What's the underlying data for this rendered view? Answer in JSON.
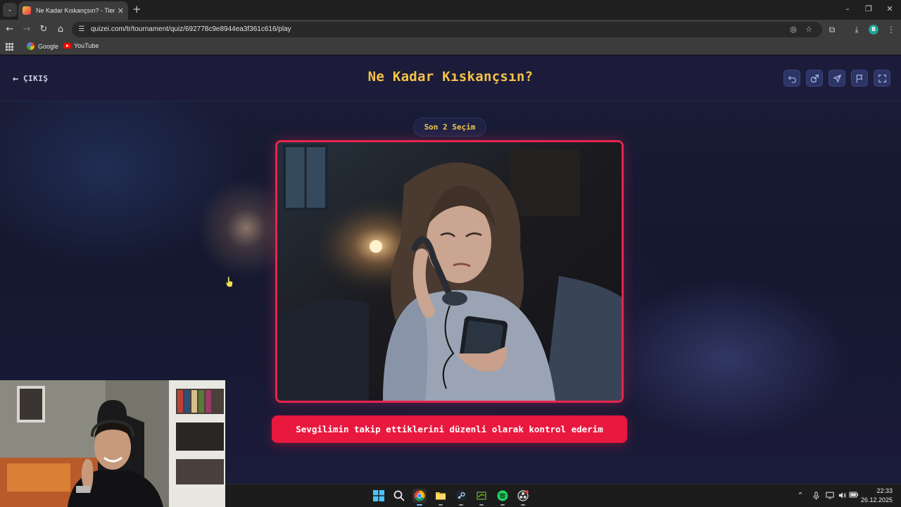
{
  "browser": {
    "tab_title": "Ne Kadar Kıskançsın? - Tier List",
    "url": "quizei.com/tr/tournament/quiz/692778c9e8944ea3f361c616/play",
    "profile_initial": "B",
    "bookmarks": [
      {
        "label": "Google",
        "icon": "google-icon"
      },
      {
        "label": "YouTube",
        "icon": "youtube-icon"
      }
    ]
  },
  "header": {
    "exit_label": "ÇIKIŞ",
    "title": "Ne Kadar Kıskançsın?",
    "actions": [
      "undo-icon",
      "share-icon",
      "send-icon",
      "flag-icon",
      "fullscreen-icon"
    ]
  },
  "round": {
    "label": "Son 2 Seçim"
  },
  "choice": {
    "caption": "Sevgilimin takip ettiklerini düzenli olarak kontrol ederim",
    "image_subject": "worried-woman-on-phone-photo"
  },
  "taskbar": {
    "apps": [
      "windows-start-icon",
      "search-icon",
      "chrome-icon",
      "file-explorer-icon",
      "steam-icon",
      "nvidia-icon",
      "spotify-icon",
      "obs-icon"
    ],
    "time": "22:33",
    "date": "26.12.2025"
  },
  "colors": {
    "title_accent": "#f6c446",
    "card_border": "#e8244f",
    "caption_bg": "#e8183f",
    "header_bg": "#1c1c3a"
  }
}
